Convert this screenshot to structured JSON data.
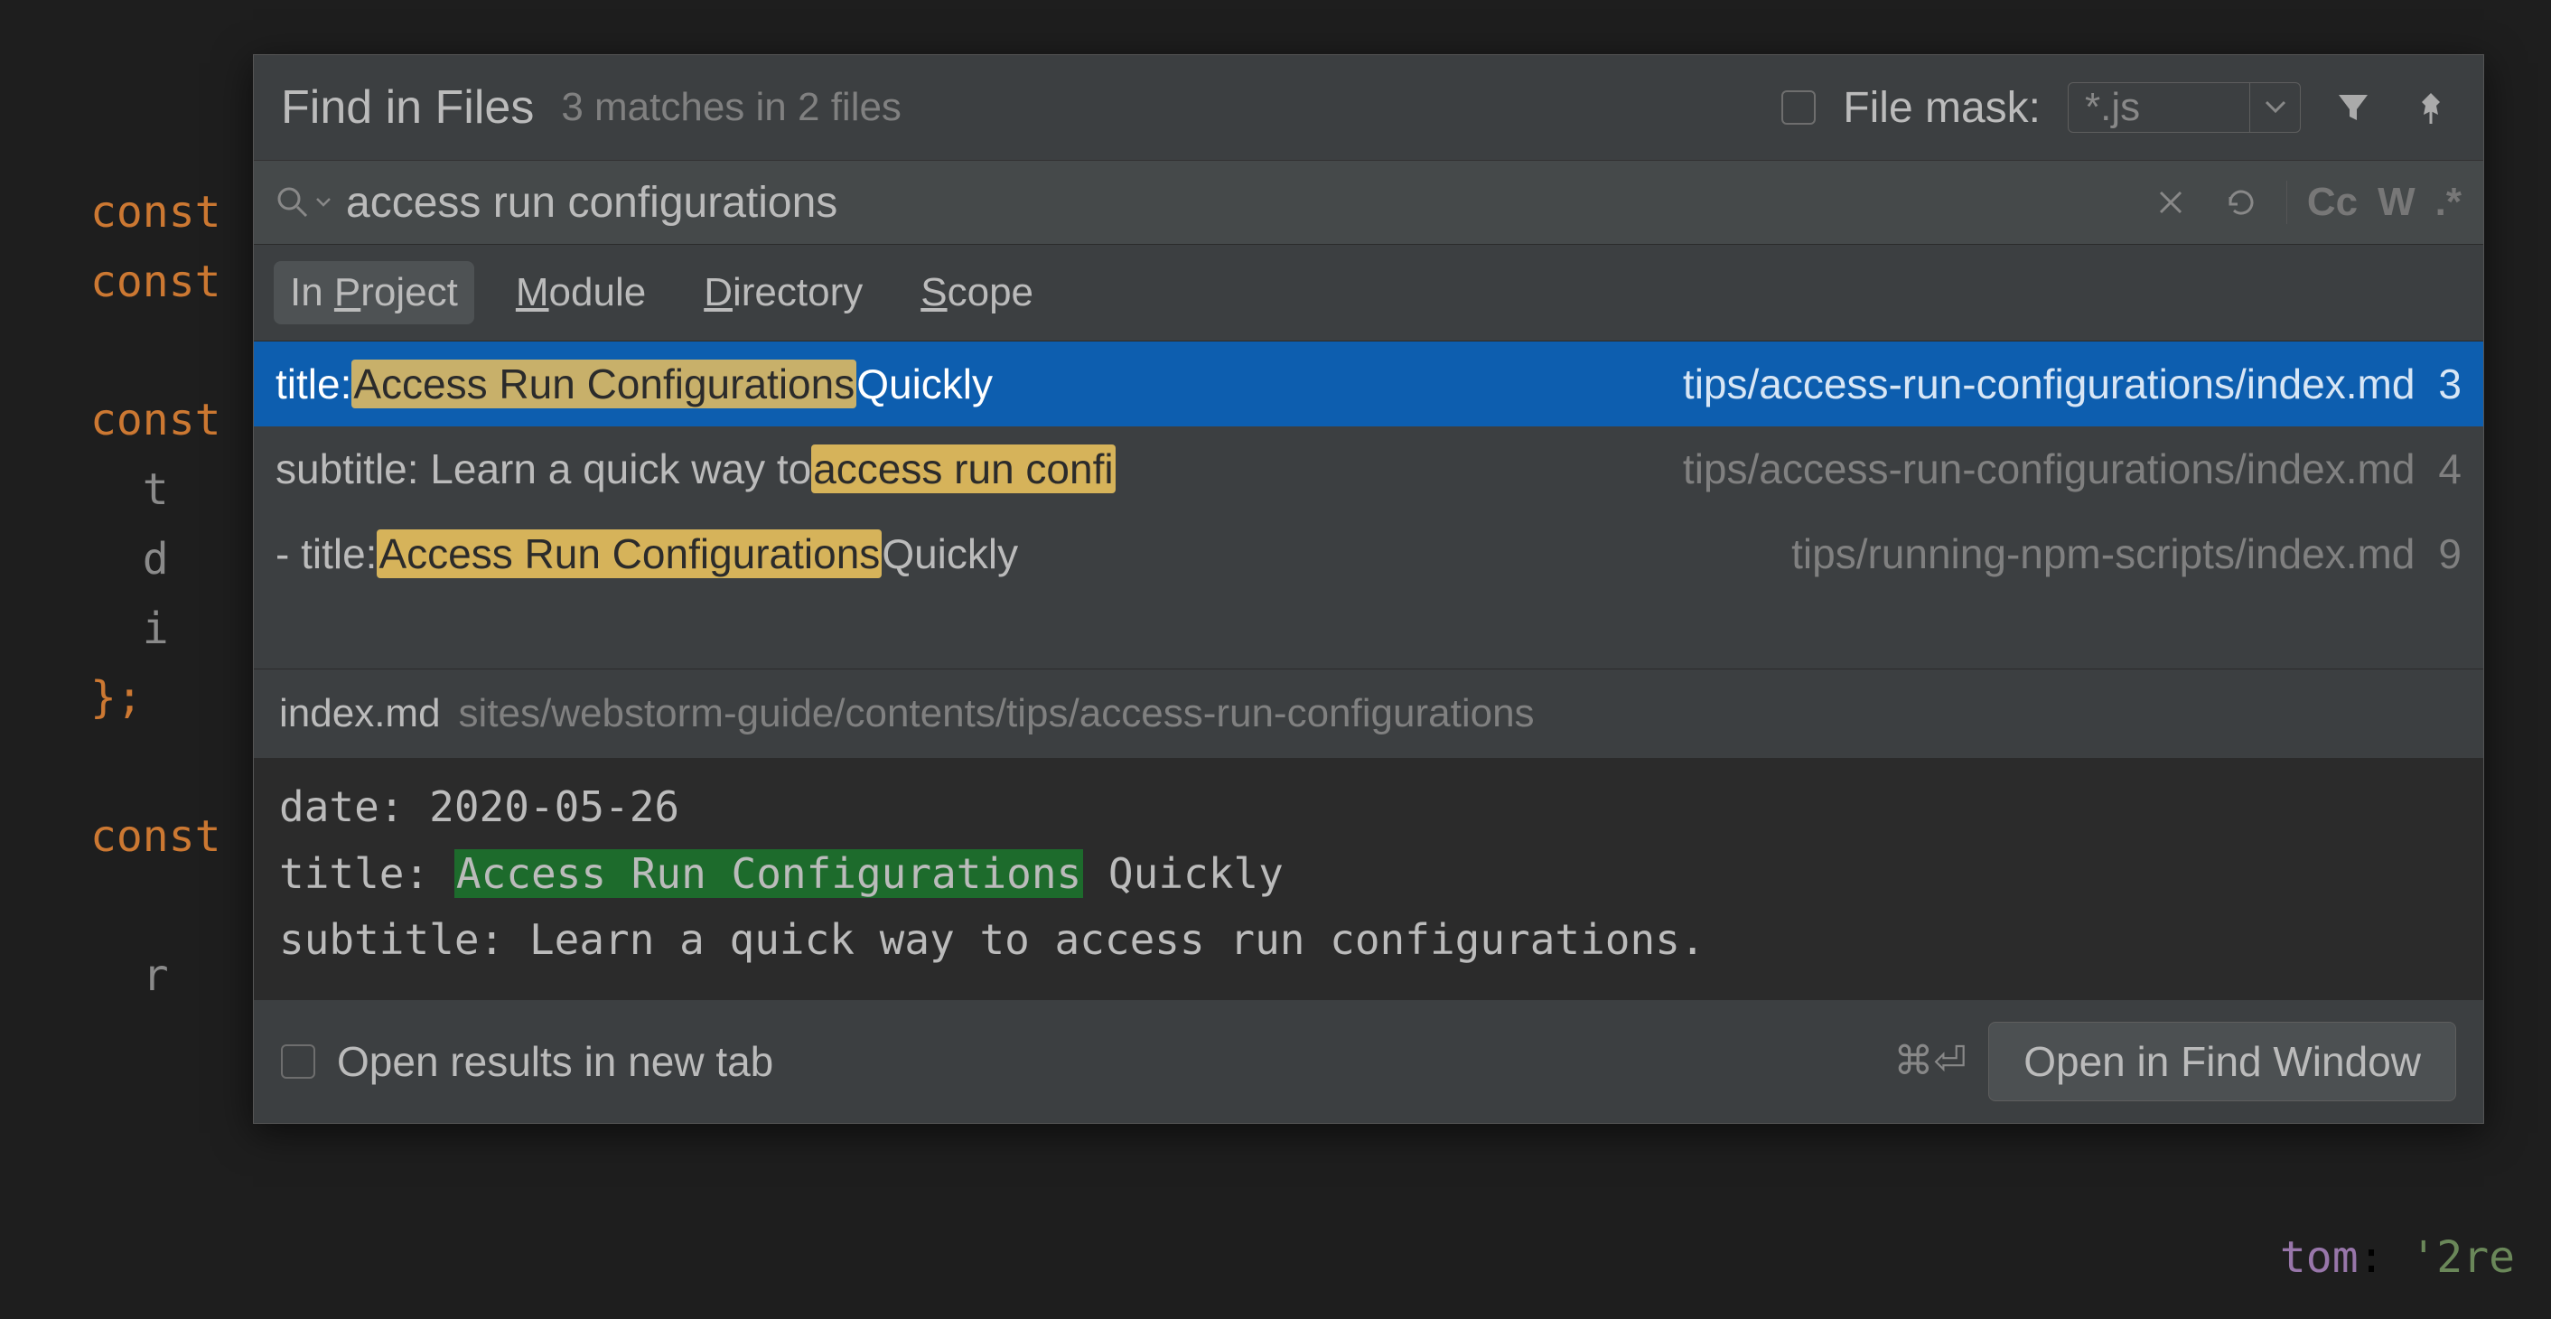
{
  "dialog": {
    "title": "Find in Files",
    "matches": "3 matches in 2 files",
    "file_mask_label": "File mask:",
    "file_mask_value": "*.js"
  },
  "search": {
    "query": "access run configurations",
    "toggles": {
      "case": "Cc",
      "words": "W",
      "regex": ".*"
    }
  },
  "scopes": {
    "in_project": "In Project",
    "module": "Module",
    "directory": "Directory",
    "scope": "Scope"
  },
  "results": [
    {
      "prefix": "title: ",
      "match": "Access Run Configurations",
      "suffix": " Quickly",
      "path": "tips/access-run-configurations/index.md",
      "line": "3",
      "selected": true
    },
    {
      "prefix": "subtitle: Learn a quick way to ",
      "match": "access run confi",
      "suffix": "",
      "path": "tips/access-run-configurations/index.md",
      "line": "4",
      "selected": false
    },
    {
      "prefix": "- title: ",
      "match": "Access Run Configurations",
      "suffix": " Quickly",
      "path": "tips/running-npm-scripts/index.md",
      "line": "9",
      "selected": false
    }
  ],
  "preview": {
    "filename": "index.md",
    "dirpath": "sites/webstorm-guide/contents/tips/access-run-configurations",
    "lines": {
      "l1_pre": "date: ",
      "l1_val": "2020-05-26",
      "l2_pre": "title: ",
      "l2_match": "Access Run Configurations",
      "l2_post": " Quickly",
      "l3_pre": "subtitle: ",
      "l3_val": "Learn a quick way to access run configurations."
    }
  },
  "footer": {
    "open_new_tab": "Open results in new tab",
    "shortcut": "⌘⏎",
    "open_find_window": "Open in Find Window"
  },
  "background": {
    "kw": "const",
    "frag1": "t",
    "frag2": "d",
    "frag3": "i",
    "brace": "};",
    "frag4": "r",
    "bottom_prop": "tom",
    "bottom_colon": ": ",
    "bottom_val": "'2re"
  }
}
